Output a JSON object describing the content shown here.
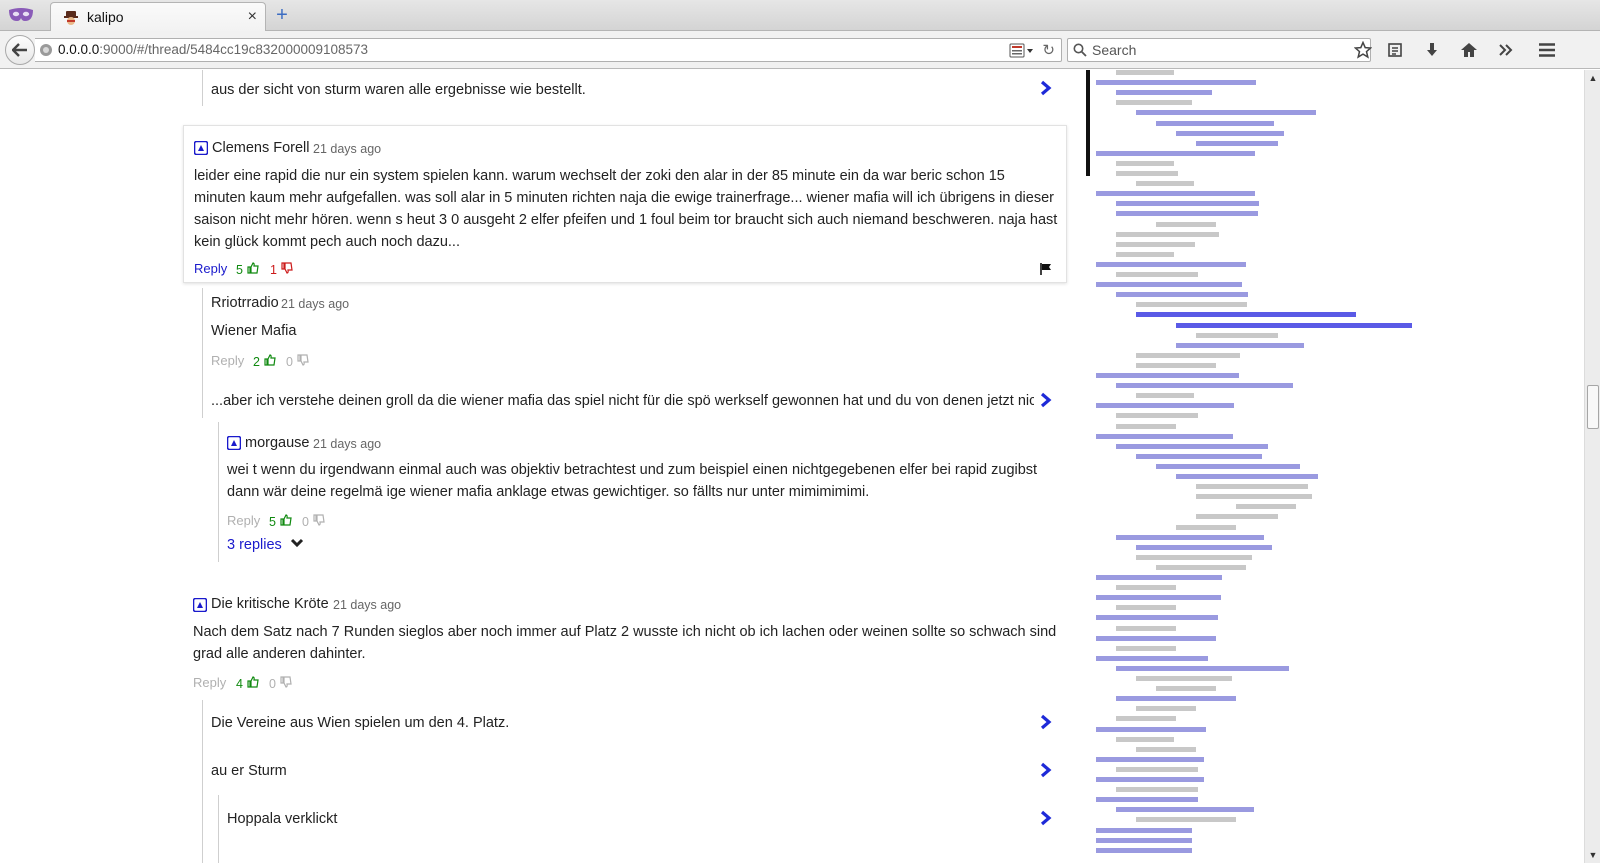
{
  "browser": {
    "tab_title": "kalipo",
    "tab_close": "×",
    "new_tab": "+",
    "url_host": "0.0.0.0",
    "url_path": ":9000/#/thread/5484cc19c832000009108573",
    "search_placeholder": "Search",
    "reload": "↻"
  },
  "thread": {
    "collapsed_top": "aus der sicht von sturm waren alle ergebnisse wie bestellt.",
    "focused_comment": {
      "author": "Clemens Forell",
      "time": "21 days ago",
      "text": "leider eine rapid die nur ein system spielen kann. warum wechselt der zoki den alar in der 85 minute ein da war beric schon 15 minuten kaum mehr aufgefallen. was soll alar in 5 minuten richten naja die ewige trainerfrage... wiener mafia will ich übrigens in dieser saison nicht mehr hören. wenn s heut 3 0 ausgeht 2 elfer pfeifen und 1 foul beim tor braucht sich auch niemand beschweren. naja hast kein glück kommt pech auch noch dazu...",
      "reply": "Reply",
      "likes": "5",
      "dislikes": "1"
    },
    "reply_1": {
      "author": "Rriotrradio",
      "time": "21 days ago",
      "text": "Wiener Mafia",
      "reply": "Reply",
      "likes": "2",
      "dislikes": "0"
    },
    "collapsed_2": "...aber ich verstehe deinen groll da die wiener mafia das spiel nicht für die spö werkself gewonnen hat und du von denen jetzt nicht",
    "reply_2": {
      "author": "morgause",
      "time": "21 days ago",
      "text": "wei t wenn du irgendwann einmal auch was objektiv betrachtest und zum beispiel einen nichtgegebenen elfer bei rapid zugibst dann wär deine regelmä ige wiener mafia anklage etwas gewichtiger. so fällts nur unter mimimimimi.",
      "reply": "Reply",
      "likes": "5",
      "dislikes": "0",
      "replies_label": "3 replies"
    },
    "comment_3": {
      "author": "Die kritische Kröte",
      "time": "21 days ago",
      "text": "Nach dem Satz nach 7 Runden sieglos aber noch immer auf Platz 2 wusste ich nicht ob ich lachen oder weinen sollte so schwach sind grad alle anderen dahinter.",
      "reply": "Reply",
      "likes": "4",
      "dislikes": "0"
    },
    "collapsed_3a": "Die Vereine aus Wien spielen um den 4. Platz.",
    "collapsed_3b": "au er Sturm",
    "collapsed_3c": "Hoppala verklickt"
  },
  "colors": {
    "link_blue": "#1a1acc",
    "like_green": "#108a10",
    "dislike_red": "#cc1a1a",
    "minimap_grey": "#c8c8c8",
    "minimap_lavender": "#9a9ae0",
    "minimap_blue": "#5a5ae6"
  },
  "minimap": [
    {
      "indent": 1,
      "len": 58,
      "tone": "grey"
    },
    {
      "indent": 0,
      "len": 160,
      "tone": "lavender"
    },
    {
      "indent": 1,
      "len": 96,
      "tone": "lavender"
    },
    {
      "indent": 1,
      "len": 76,
      "tone": "grey"
    },
    {
      "indent": 2,
      "len": 180,
      "tone": "lavender"
    },
    {
      "indent": 3,
      "len": 118,
      "tone": "lavender"
    },
    {
      "indent": 4,
      "len": 108,
      "tone": "lavender"
    },
    {
      "indent": 5,
      "len": 82,
      "tone": "lavender"
    },
    {
      "indent": 0,
      "len": 159,
      "tone": "lavender"
    },
    {
      "indent": 1,
      "len": 58,
      "tone": "grey"
    },
    {
      "indent": 1,
      "len": 62,
      "tone": "grey"
    },
    {
      "indent": 2,
      "len": 58,
      "tone": "grey"
    },
    {
      "indent": 0,
      "len": 159,
      "tone": "lavender"
    },
    {
      "indent": 1,
      "len": 143,
      "tone": "lavender"
    },
    {
      "indent": 1,
      "len": 142,
      "tone": "lavender"
    },
    {
      "indent": 3,
      "len": 60,
      "tone": "grey"
    },
    {
      "indent": 1,
      "len": 103,
      "tone": "grey"
    },
    {
      "indent": 1,
      "len": 79,
      "tone": "grey"
    },
    {
      "indent": 1,
      "len": 58,
      "tone": "grey"
    },
    {
      "indent": 0,
      "len": 150,
      "tone": "lavender"
    },
    {
      "indent": 1,
      "len": 82,
      "tone": "grey"
    },
    {
      "indent": 0,
      "len": 146,
      "tone": "lavender"
    },
    {
      "indent": 1,
      "len": 132,
      "tone": "lavender"
    },
    {
      "indent": 2,
      "len": 111,
      "tone": "grey"
    },
    {
      "indent": 2,
      "len": 220,
      "tone": "blue"
    },
    {
      "indent": 4,
      "len": 236,
      "tone": "blue"
    },
    {
      "indent": 5,
      "len": 82,
      "tone": "grey"
    },
    {
      "indent": 4,
      "len": 128,
      "tone": "lavender"
    },
    {
      "indent": 2,
      "len": 104,
      "tone": "grey"
    },
    {
      "indent": 2,
      "len": 80,
      "tone": "grey"
    },
    {
      "indent": 0,
      "len": 143,
      "tone": "lavender"
    },
    {
      "indent": 1,
      "len": 177,
      "tone": "lavender"
    },
    {
      "indent": 2,
      "len": 58,
      "tone": "grey"
    },
    {
      "indent": 0,
      "len": 138,
      "tone": "lavender"
    },
    {
      "indent": 1,
      "len": 82,
      "tone": "grey"
    },
    {
      "indent": 1,
      "len": 60,
      "tone": "grey"
    },
    {
      "indent": 0,
      "len": 137,
      "tone": "lavender"
    },
    {
      "indent": 1,
      "len": 152,
      "tone": "lavender"
    },
    {
      "indent": 2,
      "len": 126,
      "tone": "lavender"
    },
    {
      "indent": 3,
      "len": 144,
      "tone": "lavender"
    },
    {
      "indent": 4,
      "len": 142,
      "tone": "lavender"
    },
    {
      "indent": 5,
      "len": 112,
      "tone": "grey"
    },
    {
      "indent": 5,
      "len": 116,
      "tone": "grey"
    },
    {
      "indent": 7,
      "len": 60,
      "tone": "grey"
    },
    {
      "indent": 5,
      "len": 82,
      "tone": "grey"
    },
    {
      "indent": 4,
      "len": 60,
      "tone": "grey"
    },
    {
      "indent": 1,
      "len": 148,
      "tone": "lavender"
    },
    {
      "indent": 2,
      "len": 136,
      "tone": "lavender"
    },
    {
      "indent": 2,
      "len": 116,
      "tone": "grey"
    },
    {
      "indent": 3,
      "len": 90,
      "tone": "grey"
    },
    {
      "indent": 0,
      "len": 126,
      "tone": "lavender"
    },
    {
      "indent": 1,
      "len": 60,
      "tone": "grey"
    },
    {
      "indent": 0,
      "len": 125,
      "tone": "lavender"
    },
    {
      "indent": 1,
      "len": 60,
      "tone": "grey"
    },
    {
      "indent": 0,
      "len": 122,
      "tone": "lavender"
    },
    {
      "indent": 1,
      "len": 60,
      "tone": "grey"
    },
    {
      "indent": 0,
      "len": 120,
      "tone": "lavender"
    },
    {
      "indent": 1,
      "len": 60,
      "tone": "grey"
    },
    {
      "indent": 0,
      "len": 112,
      "tone": "lavender"
    },
    {
      "indent": 1,
      "len": 173,
      "tone": "lavender"
    },
    {
      "indent": 2,
      "len": 96,
      "tone": "grey"
    },
    {
      "indent": 3,
      "len": 60,
      "tone": "grey"
    },
    {
      "indent": 1,
      "len": 120,
      "tone": "lavender"
    },
    {
      "indent": 2,
      "len": 60,
      "tone": "grey"
    },
    {
      "indent": 1,
      "len": 60,
      "tone": "grey"
    },
    {
      "indent": 0,
      "len": 110,
      "tone": "lavender"
    },
    {
      "indent": 1,
      "len": 58,
      "tone": "grey"
    },
    {
      "indent": 2,
      "len": 60,
      "tone": "grey"
    },
    {
      "indent": 0,
      "len": 108,
      "tone": "lavender"
    },
    {
      "indent": 1,
      "len": 82,
      "tone": "grey"
    },
    {
      "indent": 0,
      "len": 108,
      "tone": "lavender"
    },
    {
      "indent": 1,
      "len": 82,
      "tone": "grey"
    },
    {
      "indent": 0,
      "len": 102,
      "tone": "lavender"
    },
    {
      "indent": 1,
      "len": 138,
      "tone": "lavender"
    },
    {
      "indent": 2,
      "len": 100,
      "tone": "grey"
    },
    {
      "indent": 0,
      "len": 96,
      "tone": "lavender"
    },
    {
      "indent": 0,
      "len": 96,
      "tone": "lavender"
    },
    {
      "indent": 0,
      "len": 96,
      "tone": "lavender"
    }
  ]
}
